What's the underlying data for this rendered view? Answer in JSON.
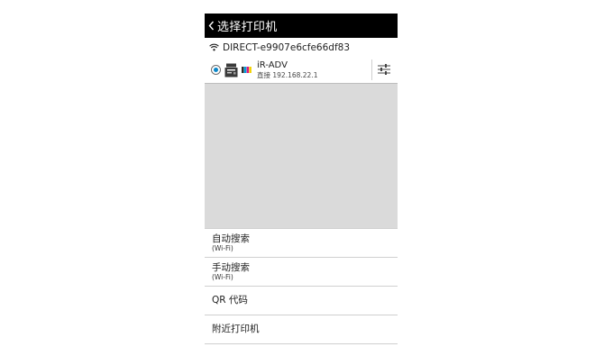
{
  "header": {
    "title": "选择打印机"
  },
  "network": {
    "ssid": "DIRECT-e9907e6cfe66df83"
  },
  "printer": {
    "name": "iR-ADV",
    "connection": "直接 192.168.22.1"
  },
  "menu": [
    {
      "title": "自动搜索",
      "sub": "(Wi-Fi)"
    },
    {
      "title": "手动搜索",
      "sub": "(Wi-Fi)"
    },
    {
      "title": "QR 代码",
      "sub": ""
    },
    {
      "title": "附近打印机",
      "sub": ""
    }
  ],
  "colors": {
    "selected": "#0a86c8",
    "bar": "#000000",
    "empty_area": "#dadada"
  },
  "icons": [
    "back-arrow-icon",
    "wifi-icon",
    "printer-icon",
    "ink-level-icon",
    "settings-sliders-icon"
  ]
}
